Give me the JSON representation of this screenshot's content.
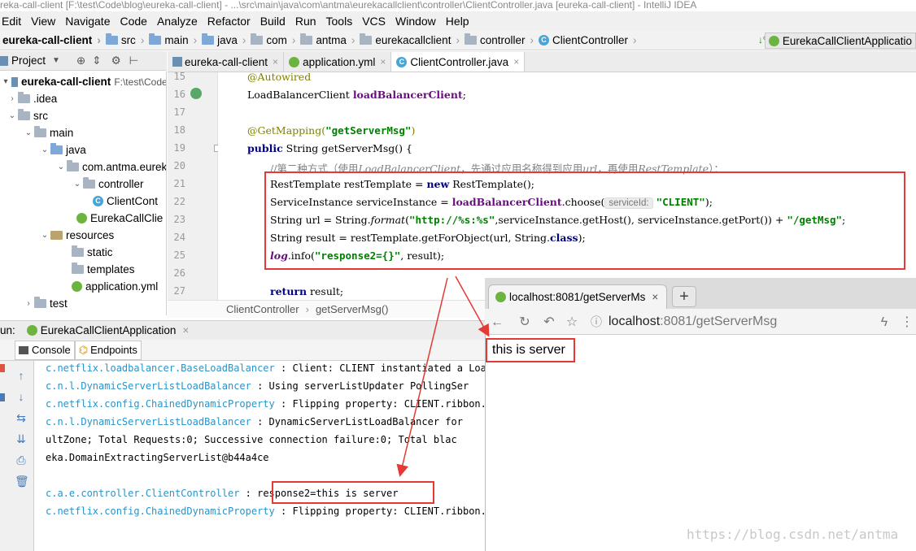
{
  "window": {
    "title": "reka-call-client [F:\\test\\Code\\blog\\eureka-call-client] - ...\\src\\main\\java\\com\\antma\\eurekacallclient\\controller\\ClientController.java [eureka-call-client] - IntelliJ IDEA"
  },
  "menu": [
    "Edit",
    "View",
    "Navigate",
    "Code",
    "Analyze",
    "Refactor",
    "Build",
    "Run",
    "Tools",
    "VCS",
    "Window",
    "Help"
  ],
  "breadcrumb": [
    "eureka-call-client",
    "src",
    "main",
    "java",
    "com",
    "antma",
    "eurekacallclient",
    "controller",
    "ClientController"
  ],
  "run_config": "EurekaCallClientApplicatio",
  "project_panel": {
    "title": "Project",
    "tree": [
      {
        "label": "eureka-call-client",
        "suffix": "F:\\test\\Code"
      },
      {
        "label": ".idea"
      },
      {
        "label": "src"
      },
      {
        "label": "main"
      },
      {
        "label": "java"
      },
      {
        "label": "com.antma.eurek"
      },
      {
        "label": "controller"
      },
      {
        "label": "ClientCont"
      },
      {
        "label": "EurekaCallClie"
      },
      {
        "label": "resources"
      },
      {
        "label": "static"
      },
      {
        "label": "templates"
      },
      {
        "label": "application.yml"
      },
      {
        "label": "test"
      }
    ]
  },
  "editor_tabs": [
    {
      "label": "eureka-call-client"
    },
    {
      "label": "application.yml"
    },
    {
      "label": "ClientController.java"
    }
  ],
  "code": {
    "line_numbers": [
      "15",
      "16",
      "17",
      "18",
      "19",
      "20",
      "21",
      "22",
      "23",
      "24",
      "25",
      "26",
      "27"
    ],
    "l15": "@Autowired",
    "l16_type": "LoadBalancerClient ",
    "l16_field": "loadBalancerClient",
    "l16_end": ";",
    "l18_ann": "@GetMapping(",
    "l18_str": "\"getServerMsg\"",
    "l18_end": ")",
    "l19_kw": "public",
    "l19_rest": " String getServerMsg() {",
    "l20_a": "//第二种方式（使用",
    "l20_b": "LoadBalancerClient",
    "l20_c": "，先通过应用名称得到应用",
    "l20_d": "url",
    "l20_e": "，再使用",
    "l20_f": "RestTemplate",
    "l20_g": "）：",
    "l21_a": "RestTemplate restTemplate = ",
    "l21_kw": "new",
    "l21_b": " RestTemplate();",
    "l22_a": "ServiceInstance serviceInstance = ",
    "l22_f": "loadBalancerClient",
    "l22_b": ".choose(",
    "l22_hint": "serviceId:",
    "l22_str": "\"CLIENT\"",
    "l22_c": ");",
    "l23_a": "String url = String.",
    "l23_m": "format",
    "l23_b": "(",
    "l23_str": "\"http://%s:%s\"",
    "l23_c": ",serviceInstance.getHost(), serviceInstance.getPort()) + ",
    "l23_str2": "\"/getMsg\"",
    "l23_d": ";",
    "l24_a": "String result = restTemplate.getForObject(url, String.",
    "l24_kw": "class",
    "l24_b": ");",
    "l25_log": "log",
    "l25_a": ".info(",
    "l25_str": "\"response2={}\"",
    "l25_b": ", result);",
    "l27_kw": "return",
    "l27_rest": " result;"
  },
  "editor_breadcrumb": [
    "ClientController",
    "getServerMsg()"
  ],
  "run_panel": {
    "label": "un:",
    "app": "EurekaCallClientApplication",
    "tabs": [
      "Console",
      "Endpoints"
    ],
    "lines": [
      {
        "cls": "c.netflix.loadbalancer.BaseLoadBalancer",
        "msg": ": Client: CLIENT instantiated a Load"
      },
      {
        "cls": "c.n.l.DynamicServerListLoadBalancer",
        "msg": ": Using serverListUpdater PollingSer"
      },
      {
        "cls": "c.netflix.config.ChainedDynamicProperty",
        "msg": ": Flipping property: CLIENT.ribbon.A"
      },
      {
        "cls": "c.n.l.DynamicServerListLoadBalancer",
        "msg": ": DynamicServerListLoadBalancer for"
      },
      {
        "cls": "",
        "msg": "ultZone;   Total Requests:0;   Successive connection failure:0;   Total blac"
      },
      {
        "cls": "",
        "msg": "eka.DomainExtractingServerList@b44a4ce"
      },
      {
        "cls": "c.a.e.controller.ClientController",
        "msg": ": response2=this is server"
      },
      {
        "cls": "c.netflix.config.ChainedDynamicProperty",
        "msg": ": Flipping property: CLIENT.ribbon.A"
      }
    ]
  },
  "browser": {
    "tab_title": "localhost:8081/getServerMs",
    "new_tab": "+",
    "url_host": "localhost",
    "url_rest": ":8081/getServerMsg",
    "content": "this is server"
  },
  "watermark": "https://blog.csdn.net/antma",
  "colors": {
    "annotation_box": "#e53935",
    "console_class": "#2a93c9",
    "keyword": "#000080",
    "string": "#008000"
  }
}
